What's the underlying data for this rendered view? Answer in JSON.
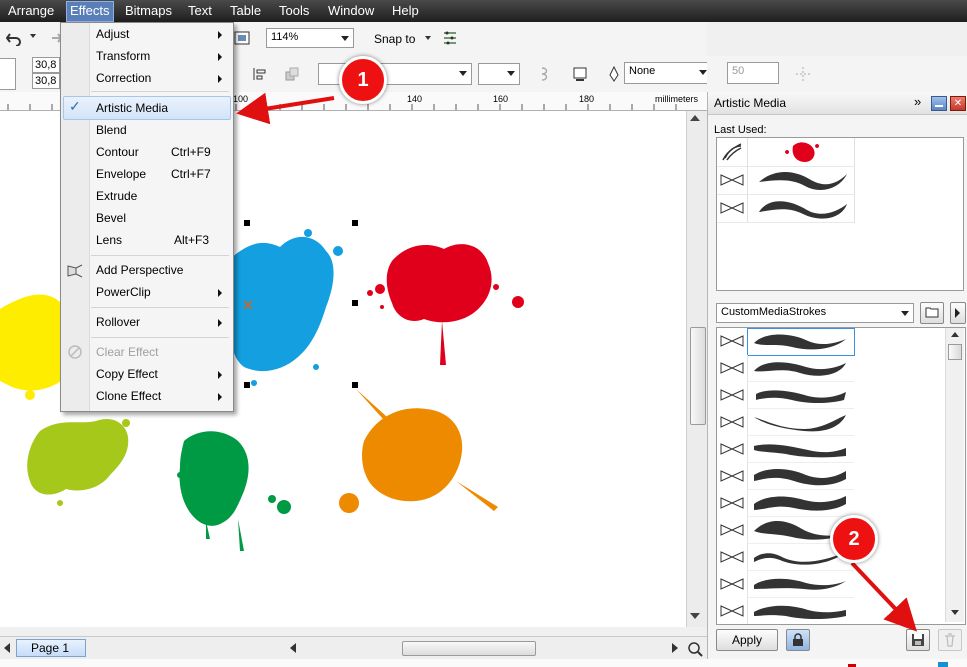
{
  "menubar": {
    "items": [
      "Arrange",
      "Effects",
      "Bitmaps",
      "Text",
      "Table",
      "Tools",
      "Window",
      "Help"
    ]
  },
  "toolbar": {
    "zoom": "114%",
    "snap_to": "Snap to",
    "x_value": "30,8",
    "y_value": "30,8",
    "outline": "None",
    "smoothing": "50"
  },
  "ruler": {
    "ticks": [
      "100",
      "140",
      "160",
      "180"
    ],
    "unit": "millimeters"
  },
  "effects_menu": {
    "items": [
      {
        "label": "Adjust",
        "shortcut": "",
        "submenu": true
      },
      {
        "label": "Transform",
        "shortcut": "",
        "submenu": true
      },
      {
        "label": "Correction",
        "shortcut": "",
        "submenu": true
      },
      {
        "label": "Artistic Media",
        "shortcut": "",
        "checked": true
      },
      {
        "label": "Blend",
        "shortcut": ""
      },
      {
        "label": "Contour",
        "shortcut": "Ctrl+F9"
      },
      {
        "label": "Envelope",
        "shortcut": "Ctrl+F7"
      },
      {
        "label": "Extrude",
        "shortcut": ""
      },
      {
        "label": "Bevel",
        "shortcut": ""
      },
      {
        "label": "Lens",
        "shortcut": "Alt+F3"
      },
      {
        "label": "Add Perspective",
        "shortcut": ""
      },
      {
        "label": "PowerClip",
        "shortcut": "",
        "submenu": true
      },
      {
        "label": "Rollover",
        "shortcut": "",
        "submenu": true
      },
      {
        "label": "Clear Effect",
        "shortcut": "",
        "disabled": true
      },
      {
        "label": "Copy Effect",
        "shortcut": "",
        "submenu": true
      },
      {
        "label": "Clone Effect",
        "shortcut": "",
        "submenu": true
      }
    ],
    "check_glyph": "✓"
  },
  "docker": {
    "title": "Artistic Media",
    "last_used_label": "Last Used:",
    "category": "CustomMediaStrokes",
    "apply_label": "Apply"
  },
  "page_tab": {
    "label": "Page 1"
  },
  "callouts": [
    "1",
    "2"
  ],
  "colors": {
    "blue": "#139fe0",
    "red": "#e0001b",
    "yellow": "#ffed00",
    "lime": "#a5c81a",
    "green": "#009a44",
    "orange": "#ee8a00",
    "callout_red": "#e01010"
  }
}
